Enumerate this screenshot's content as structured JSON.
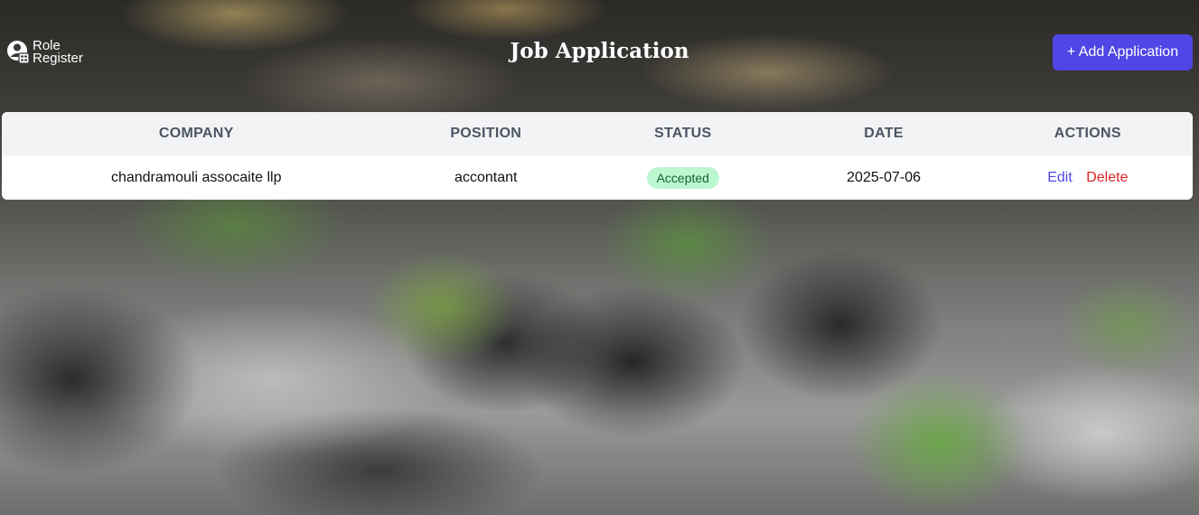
{
  "header": {
    "logo": {
      "line1": "Role",
      "line2": "Register"
    },
    "title": "Job Application",
    "add_button_label": "+ Add Application"
  },
  "table": {
    "columns": [
      "COMPANY",
      "POSITION",
      "STATUS",
      "DATE",
      "ACTIONS"
    ],
    "rows": [
      {
        "company": "chandramouli assocaite llp",
        "position": "accontant",
        "status": "Accepted",
        "date": "2025-07-06",
        "edit_label": "Edit",
        "delete_label": "Delete"
      }
    ]
  },
  "colors": {
    "accent": "#4f46e5",
    "status_accepted_bg": "#bbf7d0",
    "status_accepted_text": "#166534",
    "delete": "#dc2626"
  },
  "icons": {
    "logo": "user-register-icon"
  }
}
